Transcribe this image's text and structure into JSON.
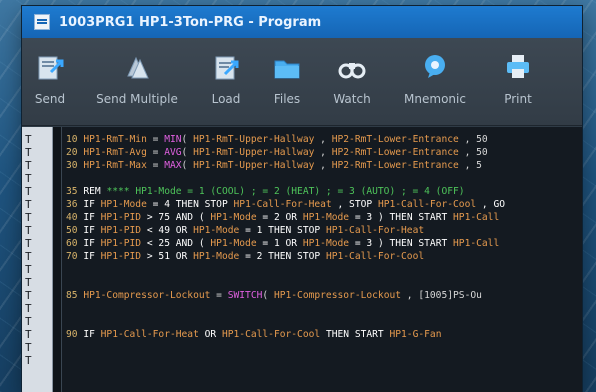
{
  "window": {
    "title": "1003PRG1 HP1-3Ton-PRG - Program"
  },
  "toolbar": {
    "items": [
      {
        "label": "Send",
        "icon": "send-icon"
      },
      {
        "label": "Send Multiple",
        "icon": "send-multiple-icon"
      },
      {
        "label": "Load",
        "icon": "load-icon"
      },
      {
        "label": "Files",
        "icon": "files-icon"
      },
      {
        "label": "Watch",
        "icon": "watch-binoculars-icon"
      },
      {
        "label": "Mnemonic",
        "icon": "mnemonic-icon"
      },
      {
        "label": "Print",
        "icon": "print-icon"
      }
    ]
  },
  "gutter": {
    "marker": "T"
  },
  "code": {
    "lines": [
      [
        [
          "num",
          "10 "
        ],
        [
          "var",
          "HP1-RmT-Min"
        ],
        [
          "sy",
          " = "
        ],
        [
          "fn",
          "MIN"
        ],
        [
          "sy",
          "( "
        ],
        [
          "var",
          "HP1-RmT-Upper-Hallway"
        ],
        [
          "sy",
          " , "
        ],
        [
          "var",
          "HP2-RmT-Lower-Entrance"
        ],
        [
          "sy",
          " , 50"
        ]
      ],
      [
        [
          "num",
          "20 "
        ],
        [
          "var",
          "HP1-RmT-Avg"
        ],
        [
          "sy",
          " = "
        ],
        [
          "fn",
          "AVG"
        ],
        [
          "sy",
          "( "
        ],
        [
          "var",
          "HP1-RmT-Upper-Hallway"
        ],
        [
          "sy",
          " , "
        ],
        [
          "var",
          "HP2-RmT-Lower-Entrance"
        ],
        [
          "sy",
          " , 50"
        ]
      ],
      [
        [
          "num",
          "30 "
        ],
        [
          "var",
          "HP1-RmT-Max"
        ],
        [
          "sy",
          " = "
        ],
        [
          "fn",
          "MAX"
        ],
        [
          "sy",
          "( "
        ],
        [
          "var",
          "HP1-RmT-Upper-Hallway"
        ],
        [
          "sy",
          " , "
        ],
        [
          "var",
          "HP2-RmT-Lower-Entrance"
        ],
        [
          "sy",
          " , 5"
        ]
      ],
      [],
      [
        [
          "num",
          "35 "
        ],
        [
          "kw",
          "REM "
        ],
        [
          "cm",
          "**** HP1-Mode = 1 (COOL) ; = 2 (HEAT) ; = 3 (AUTO) ; = 4 (OFF)"
        ]
      ],
      [
        [
          "num",
          "36 "
        ],
        [
          "kw",
          "IF "
        ],
        [
          "var",
          "HP1-Mode"
        ],
        [
          "kw",
          " = 4 THEN STOP "
        ],
        [
          "var",
          "HP1-Call-For-Heat"
        ],
        [
          "kw",
          " , STOP "
        ],
        [
          "var",
          "HP1-Call-For-Cool"
        ],
        [
          "kw",
          " , GO"
        ]
      ],
      [
        [
          "num",
          "40 "
        ],
        [
          "kw",
          "IF "
        ],
        [
          "var",
          "HP1-PID"
        ],
        [
          "kw",
          " > 75 AND ( "
        ],
        [
          "var",
          "HP1-Mode"
        ],
        [
          "kw",
          " = 2 OR "
        ],
        [
          "var",
          "HP1-Mode"
        ],
        [
          "kw",
          " = 3 ) THEN START "
        ],
        [
          "var",
          "HP1-Call"
        ]
      ],
      [
        [
          "num",
          "50 "
        ],
        [
          "kw",
          "IF "
        ],
        [
          "var",
          "HP1-PID"
        ],
        [
          "kw",
          " < 49 OR "
        ],
        [
          "var",
          "HP1-Mode"
        ],
        [
          "kw",
          " = 1 THEN STOP "
        ],
        [
          "var",
          "HP1-Call-For-Heat"
        ]
      ],
      [
        [
          "num",
          "60 "
        ],
        [
          "kw",
          "IF "
        ],
        [
          "var",
          "HP1-PID"
        ],
        [
          "kw",
          " < 25 AND ( "
        ],
        [
          "var",
          "HP1-Mode"
        ],
        [
          "kw",
          " = 1 OR "
        ],
        [
          "var",
          "HP1-Mode"
        ],
        [
          "kw",
          " = 3 ) THEN START "
        ],
        [
          "var",
          "HP1-Call"
        ]
      ],
      [
        [
          "num",
          "70 "
        ],
        [
          "kw",
          "IF "
        ],
        [
          "var",
          "HP1-PID"
        ],
        [
          "kw",
          " > 51 OR "
        ],
        [
          "var",
          "HP1-Mode"
        ],
        [
          "kw",
          " = 2 THEN STOP "
        ],
        [
          "var",
          "HP1-Call-For-Cool"
        ]
      ],
      [],
      [],
      [
        [
          "num",
          "85 "
        ],
        [
          "var",
          "HP1-Compressor-Lockout"
        ],
        [
          "sy",
          " = "
        ],
        [
          "fn",
          "SWITCH"
        ],
        [
          "sy",
          "( "
        ],
        [
          "var",
          "HP1-Compressor-Lockout"
        ],
        [
          "sy",
          " , [1005]PS-Ou"
        ]
      ],
      [],
      [],
      [
        [
          "num",
          "90 "
        ],
        [
          "kw",
          "IF "
        ],
        [
          "var",
          "HP1-Call-For-Heat"
        ],
        [
          "kw",
          " OR "
        ],
        [
          "var",
          "HP1-Call-For-Cool"
        ],
        [
          "kw",
          " THEN START "
        ],
        [
          "var",
          "HP1-G-Fan"
        ]
      ],
      [],
      []
    ]
  }
}
